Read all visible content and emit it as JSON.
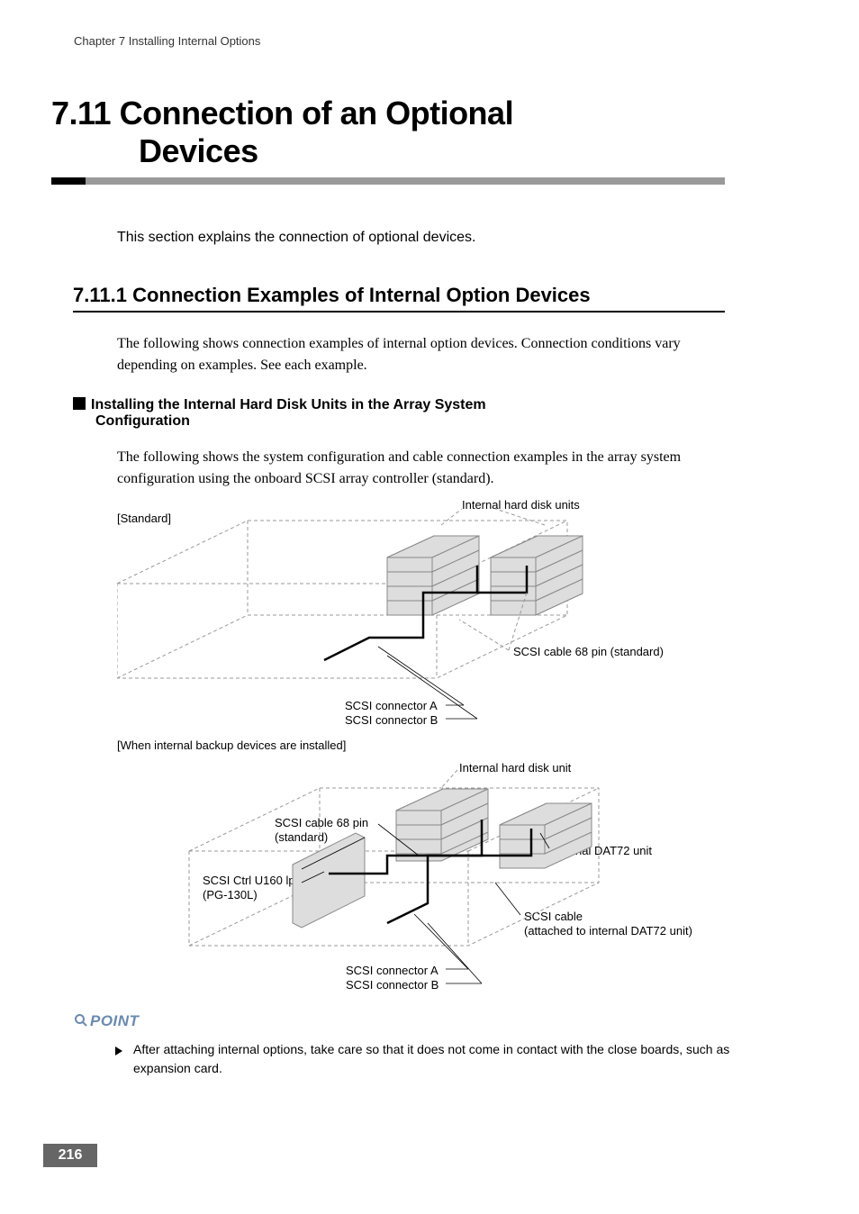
{
  "header": {
    "chapter": "Chapter 7  Installing Internal Options"
  },
  "section": {
    "number": "7.11",
    "title_line1": "Connection of an Optional",
    "title_line2": "Devices",
    "intro": "This section explains the connection of optional devices."
  },
  "subsection": {
    "number": "7.11.1",
    "title": "Connection Examples of Internal Option Devices",
    "intro": "The following shows connection examples of internal option devices. Connection conditions vary depending on examples. See each example."
  },
  "subheading": {
    "line1": "Installing the Internal Hard Disk Units in the Array System",
    "line2": "Configuration",
    "desc": "The following shows the system configuration and cable connection examples in the array system configuration using the onboard SCSI array controller (standard)."
  },
  "diagram1": {
    "caption": "[Standard]",
    "labels": {
      "hdd": "Internal hard disk units",
      "cable68": "SCSI cable 68 pin (standard)",
      "connA": "SCSI connector A",
      "connB": "SCSI connector B"
    }
  },
  "diagram2": {
    "caption": "[When internal backup devices are installed]",
    "labels": {
      "hdd": "Internal hard disk unit",
      "cable68_l1": "SCSI cable 68 pin",
      "cable68_l2": "(standard)",
      "ctrl_l1": "SCSI Ctrl U160 lp",
      "ctrl_l2": "(PG-130L)",
      "dat72": "Internal DAT72 unit",
      "cable_dat_l1": "SCSI cable",
      "cable_dat_l2": "(attached to internal DAT72 unit)",
      "connA": "SCSI connector A",
      "connB": "SCSI connector B"
    }
  },
  "point": {
    "label": "POINT",
    "text": "After attaching internal options, take care so that it does not come in contact with the close boards, such as expansion card."
  },
  "page_number": "216"
}
